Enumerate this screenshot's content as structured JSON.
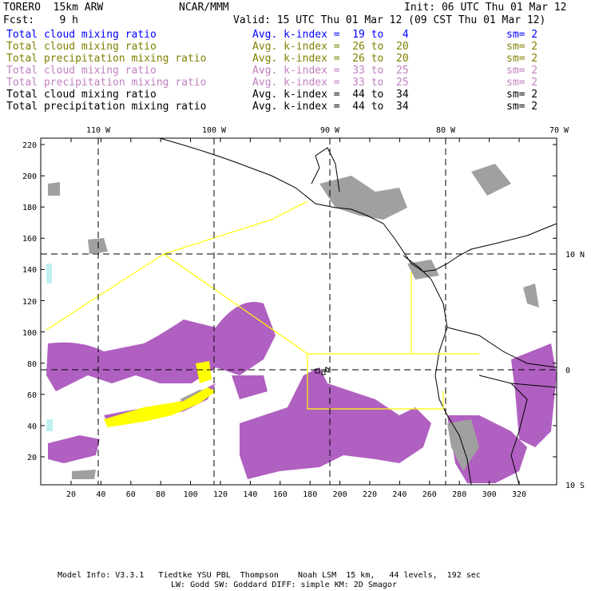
{
  "header": {
    "model": "TORERO  15km ARW",
    "org": "NCAR/MMM",
    "init": "Init: 06 UTC Thu 01 Mar 12",
    "fcst": "Fcst:    9 h",
    "valid": "Valid: 15 UTC Thu 01 Mar 12 (09 CST Thu 01 Mar 12)"
  },
  "legend": [
    {
      "field": "Total cloud mixing ratio",
      "range": "Avg. k-index =  19 to   4",
      "sm": "sm= 2",
      "color": "#0000ff"
    },
    {
      "field": "Total cloud mixing ratio",
      "range": "Avg. k-index =  26 to  20",
      "sm": "sm= 2",
      "color": "#808000"
    },
    {
      "field": "Total precipitation mixing ratio",
      "range": "Avg. k-index =  26 to  20",
      "sm": "sm= 2",
      "color": "#808000"
    },
    {
      "field": "Total cloud mixing ratio",
      "range": "Avg. k-index =  33 to  25",
      "sm": "sm= 2",
      "color": "#c080c0"
    },
    {
      "field": "Total precipitation mixing ratio",
      "range": "Avg. k-index =  33 to  25",
      "sm": "sm= 2",
      "color": "#c080c0"
    },
    {
      "field": "Total cloud mixing ratio",
      "range": "Avg. k-index =  44 to  34",
      "sm": "sm= 2",
      "color": "#000000"
    },
    {
      "field": "Total precipitation mixing ratio",
      "range": "Avg. k-index =  44 to  34",
      "sm": "sm= 2",
      "color": "#000000"
    }
  ],
  "map": {
    "lon_labels": [
      "110 W",
      "100 W",
      "90 W",
      "80 W",
      "70 W"
    ],
    "lat_labels": [
      "10 N",
      "0",
      "10 S"
    ],
    "y_grid_labels": [
      "220",
      "200",
      "180",
      "160",
      "140",
      "120",
      "100",
      "80",
      "60",
      "40",
      "20"
    ],
    "x_grid_labels": [
      "20",
      "40",
      "60",
      "80",
      "100",
      "120",
      "140",
      "160",
      "180",
      "200",
      "220",
      "240",
      "260",
      "280",
      "300",
      "320"
    ],
    "colors": {
      "cloud": "#a0a0a0",
      "precip": "#b060c0",
      "yellow": "#ffff00",
      "cyan": "#c0f0f0"
    }
  },
  "footer": {
    "line1": "Model Info: V3.3.1   Tiedtke YSU PBL  Thompson    Noah LSM  15 km,   44 levels,  192 sec",
    "line2": "LW: Godd SW: Goddard DIFF: simple KM: 2D Smagor"
  }
}
